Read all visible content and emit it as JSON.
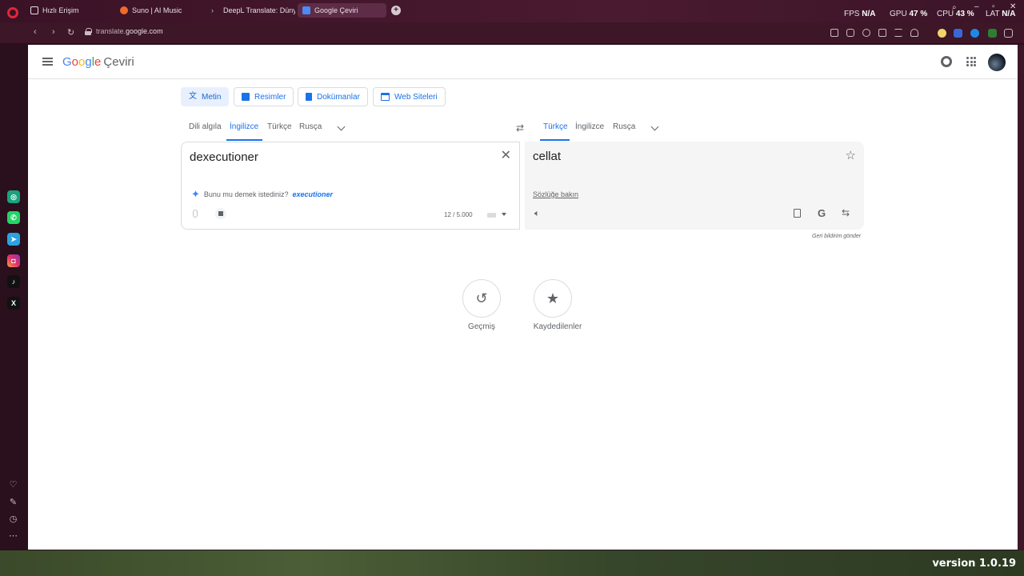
{
  "browser": {
    "tabs": [
      {
        "label": "Hızlı Erişim",
        "icon": "grid-icon"
      },
      {
        "label": "Suno | AI Music",
        "icon": "suno-icon"
      },
      {
        "label": "DeepL Translate: Dünyanın",
        "icon": "deepl-icon"
      },
      {
        "label": "Google Çeviri",
        "icon": "google-translate-icon"
      }
    ],
    "new_tab": "+",
    "stats": {
      "fps_label": "FPS",
      "fps_value": "N/A",
      "gpu_label": "GPU",
      "gpu_value": "47 %",
      "cpu_label": "CPU",
      "cpu_value": "43 %",
      "lat_label": "LAT",
      "lat_value": "N/A"
    },
    "url_domain": "translate.google.com",
    "url_prefix": "translate.",
    "url_host": "google.com"
  },
  "header": {
    "logo_letters": [
      "G",
      "o",
      "o",
      "g",
      "l",
      "e"
    ],
    "product": "Çeviri"
  },
  "modes": [
    {
      "label": "Metin",
      "icon": "translate-icon"
    },
    {
      "label": "Resimler",
      "icon": "image-icon"
    },
    {
      "label": "Dokümanlar",
      "icon": "document-icon"
    },
    {
      "label": "Web Siteleri",
      "icon": "website-icon"
    }
  ],
  "source_langs": [
    "Dili algıla",
    "İngilizce",
    "Türkçe",
    "Rusça"
  ],
  "target_langs": [
    "Türkçe",
    "İngilizce",
    "Rusça"
  ],
  "source": {
    "text": "dexecutioner",
    "suggest_prefix": "Bunu mu demek istediniz?",
    "suggest_word": "executioner",
    "char_count": "12 / 5.000"
  },
  "target": {
    "text": "cellat",
    "dict_link": "Sözlüğe bakın",
    "google_letter": "G"
  },
  "feedback": "Geri bildirim gönder",
  "history_label": "Geçmiş",
  "saved_label": "Kaydedilenler",
  "version": "version 1.0.19",
  "colors": {
    "accent": "#1a73e8",
    "chrome": "#3a1226"
  }
}
